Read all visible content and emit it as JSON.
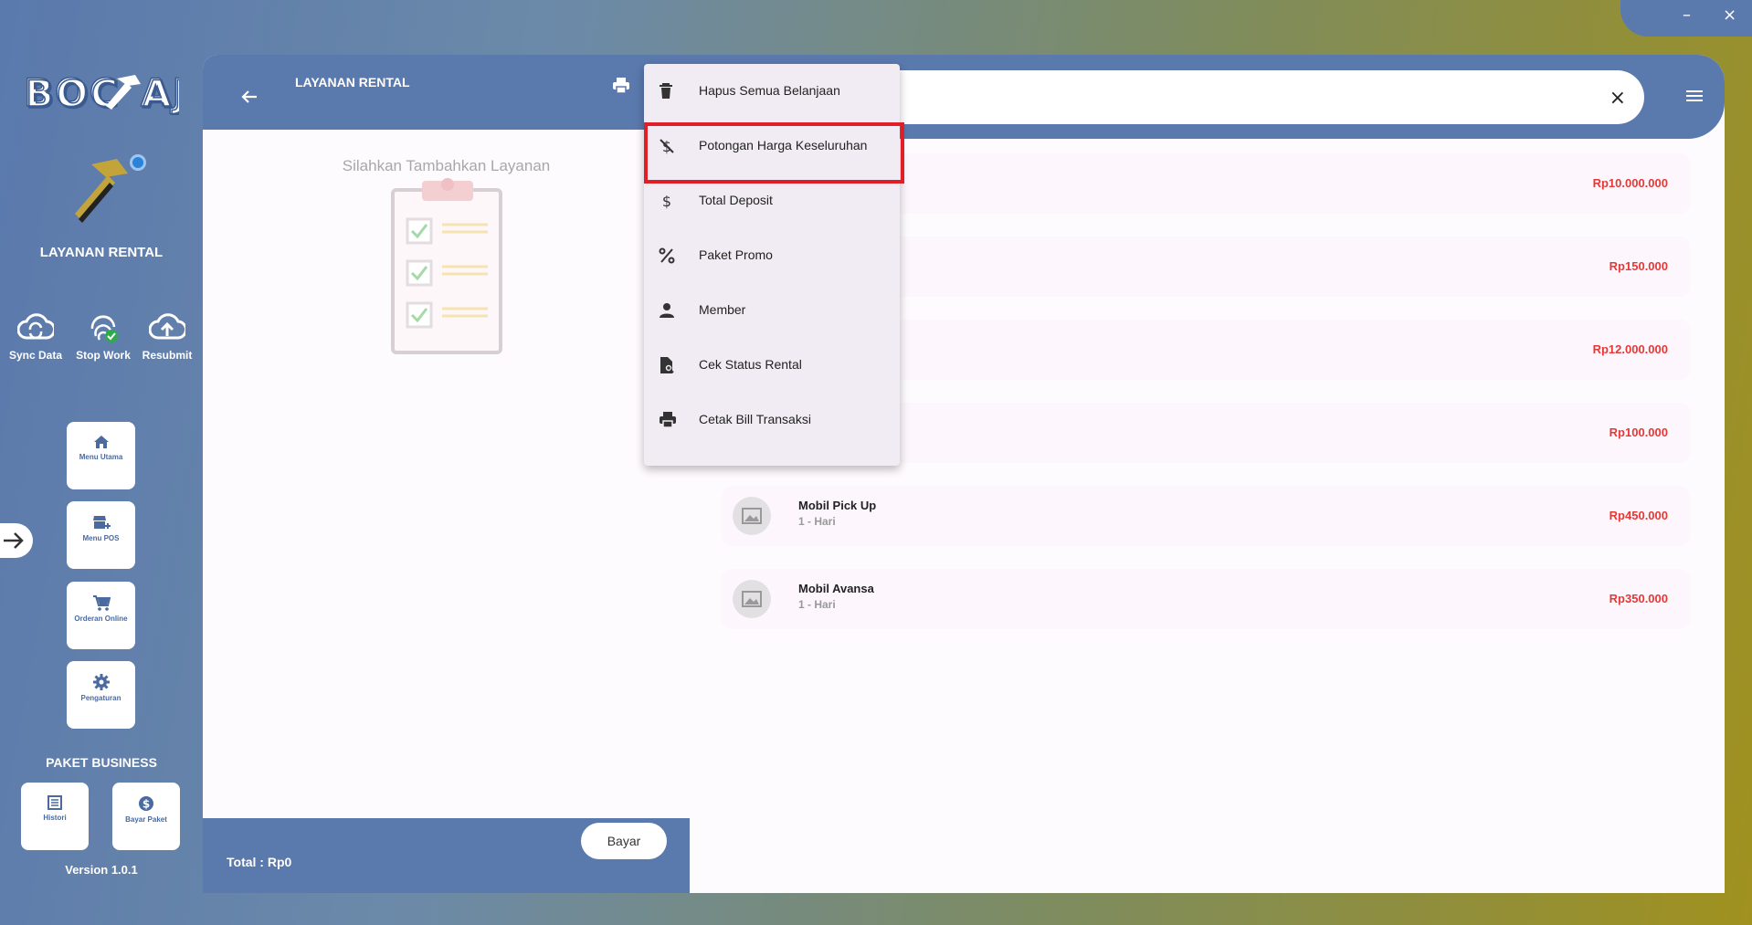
{
  "window": {
    "minimize": "–",
    "close": "×"
  },
  "sidebar": {
    "logo": "BOC AJA",
    "app_name": "LAYANAN RENTAL",
    "quick_actions": [
      "Sync Data",
      "Stop Work",
      "Resubmit"
    ],
    "nav": [
      "Menu Utama",
      "Menu POS",
      "Orderan Online",
      "Pengaturan"
    ],
    "paket_title": "PAKET BUSINESS",
    "paket_buttons": [
      "Histori",
      "Bayar Paket"
    ],
    "version": "Version 1.0.1"
  },
  "cart": {
    "title": "LAYANAN RENTAL",
    "empty_text": "Silahkan Tambahkan Layanan",
    "total_label": "Total :  Rp0",
    "pay_button": "Bayar"
  },
  "search": {
    "placeholder": "",
    "clear": "×"
  },
  "services": [
    {
      "name": "",
      "duration": "",
      "price": "Rp10.000.000"
    },
    {
      "name": "",
      "duration": "",
      "price": "Rp150.000"
    },
    {
      "name": "",
      "duration": "",
      "price": "Rp12.000.000"
    },
    {
      "name": "",
      "duration": "",
      "price": "Rp100.000"
    },
    {
      "name": "Mobil Pick Up",
      "duration": "1 - Hari",
      "price": "Rp450.000"
    },
    {
      "name": "Mobil Avansa",
      "duration": "1 - Hari",
      "price": "Rp350.000"
    }
  ],
  "menu": {
    "items": [
      {
        "label": "Hapus Semua Belanjaan",
        "icon": "trash-icon"
      },
      {
        "label": "Potongan Harga Keseluruhan",
        "icon": "money-off-icon"
      },
      {
        "label": "Total Deposit",
        "icon": "dollar-icon"
      },
      {
        "label": "Paket Promo",
        "icon": "percent-icon"
      },
      {
        "label": "Member",
        "icon": "person-icon"
      },
      {
        "label": "Cek Status Rental",
        "icon": "document-search-icon"
      },
      {
        "label": "Cetak Bill Transaksi",
        "icon": "print-icon"
      }
    ],
    "highlighted_index": 1
  },
  "colors": {
    "primary": "#5a79ad",
    "accent_gold": "#a0911f",
    "price": "#e53935",
    "highlight": "#e01e28"
  }
}
